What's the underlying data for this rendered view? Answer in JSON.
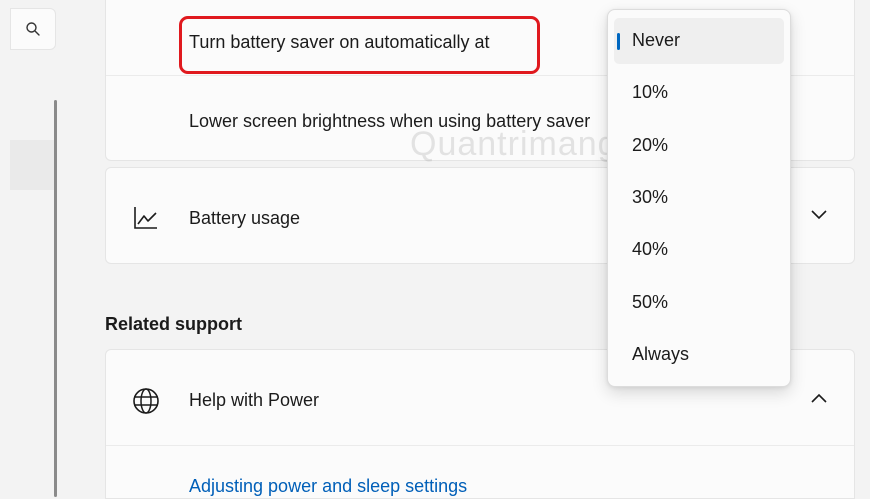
{
  "nav": {
    "search_icon": "search-icon"
  },
  "battery_saver": {
    "auto_on_label": "Turn battery saver on automatically at",
    "lower_brightness_label": "Lower screen brightness when using battery saver"
  },
  "battery_usage": {
    "label": "Battery usage",
    "icon": "line-chart-icon"
  },
  "related_support": {
    "heading": "Related support",
    "help_label": "Help with Power",
    "help_icon": "globe-icon",
    "link": "Adjusting power and sleep settings"
  },
  "dropdown": {
    "options": [
      "Never",
      "10%",
      "20%",
      "30%",
      "40%",
      "50%",
      "Always"
    ],
    "selected": "Never"
  },
  "watermark": "Quantrimang",
  "colors": {
    "accent": "#0067c0",
    "highlight": "#e0191e",
    "link": "#005fb8"
  }
}
